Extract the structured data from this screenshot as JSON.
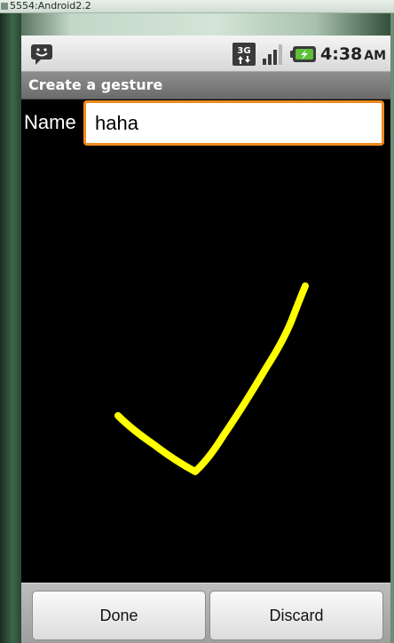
{
  "window": {
    "title": "5554:Android2.2"
  },
  "status_bar": {
    "time": "4:38",
    "ampm": "AM",
    "icons": [
      "messaging-icon",
      "3g-data-icon",
      "signal-strength-icon",
      "battery-charging-icon"
    ],
    "network_label": "3G"
  },
  "app": {
    "title": "Create a gesture"
  },
  "form": {
    "name_label": "Name",
    "name_value": "haha"
  },
  "gesture": {
    "stroke_color": "#ffff00",
    "shape": "checkmark"
  },
  "buttons": {
    "done_label": "Done",
    "discard_label": "Discard"
  },
  "colors": {
    "input_focus_border": "#f08a1c",
    "title_bar": "#7b7b7b",
    "background": "#000000"
  }
}
